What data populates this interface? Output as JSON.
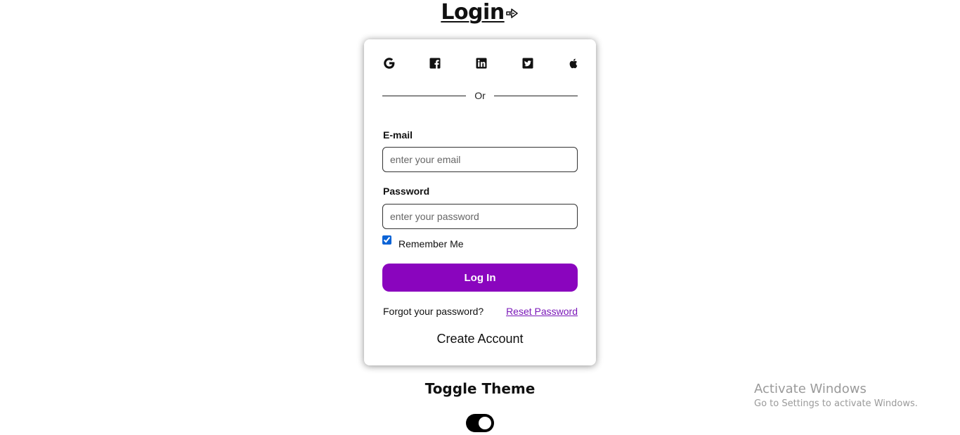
{
  "header": {
    "title": "Login",
    "title_icon": "login-arrow-icon"
  },
  "social": [
    {
      "name": "google",
      "icon": "google-icon"
    },
    {
      "name": "facebook",
      "icon": "facebook-icon"
    },
    {
      "name": "linkedin",
      "icon": "linkedin-icon"
    },
    {
      "name": "twitter",
      "icon": "twitter-icon"
    },
    {
      "name": "apple",
      "icon": "apple-icon"
    }
  ],
  "divider": {
    "text": "Or"
  },
  "form": {
    "email_label": "E-mail",
    "email_placeholder": "enter your email",
    "email_value": "",
    "password_label": "Password",
    "password_placeholder": "enter your password",
    "password_value": "",
    "remember_label": "Remember Me",
    "remember_checked": true,
    "login_button": "Log In",
    "forgot_text": "Forgot your password?",
    "reset_link": "Reset Password",
    "create_account": "Create Account"
  },
  "theme": {
    "title": "Toggle Theme",
    "toggle_on": true
  },
  "watermark": {
    "title": "Activate Windows",
    "subtitle": "Go to Settings to activate Windows."
  },
  "colors": {
    "accent": "#8a05be",
    "link": "#7a17b8",
    "checkbox": "#0b63d6",
    "watermark": "#9a9a9a"
  }
}
